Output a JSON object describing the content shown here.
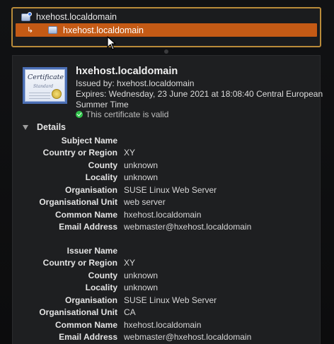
{
  "chain": {
    "root_label": "hxehost.localdomain",
    "leaf_label": "hxehost.localdomain"
  },
  "certificate": {
    "image_word": "Certificate",
    "image_sub": "Standard",
    "title": "hxehost.localdomain",
    "issued_by": "Issued by: hxehost.localdomain",
    "expires_line1": "Expires: Wednesday, 23 June 2021 at 18:08:40 Central European",
    "expires_line2": "Summer Time",
    "status": "This certificate is valid"
  },
  "details": {
    "label": "Details",
    "subject": {
      "title": "Subject Name",
      "rows": [
        {
          "label": "Country or Region",
          "value": "XY"
        },
        {
          "label": "County",
          "value": "unknown"
        },
        {
          "label": "Locality",
          "value": "unknown"
        },
        {
          "label": "Organisation",
          "value": "SUSE Linux Web Server"
        },
        {
          "label": "Organisational Unit",
          "value": "web server"
        },
        {
          "label": "Common Name",
          "value": "hxehost.localdomain"
        },
        {
          "label": "Email Address",
          "value": "webmaster@hxehost.localdomain"
        }
      ]
    },
    "issuer": {
      "title": "Issuer Name",
      "rows": [
        {
          "label": "Country or Region",
          "value": "XY"
        },
        {
          "label": "County",
          "value": "unknown"
        },
        {
          "label": "Locality",
          "value": "unknown"
        },
        {
          "label": "Organisation",
          "value": "SUSE Linux Web Server"
        },
        {
          "label": "Organisational Unit",
          "value": "CA"
        },
        {
          "label": "Common Name",
          "value": "hxehost.localdomain"
        },
        {
          "label": "Email Address",
          "value": "webmaster@hxehost.localdomain"
        }
      ]
    }
  },
  "colors": {
    "selection": "#c45a15",
    "focus_ring": "#b98b3a",
    "valid": "#30c24a"
  }
}
